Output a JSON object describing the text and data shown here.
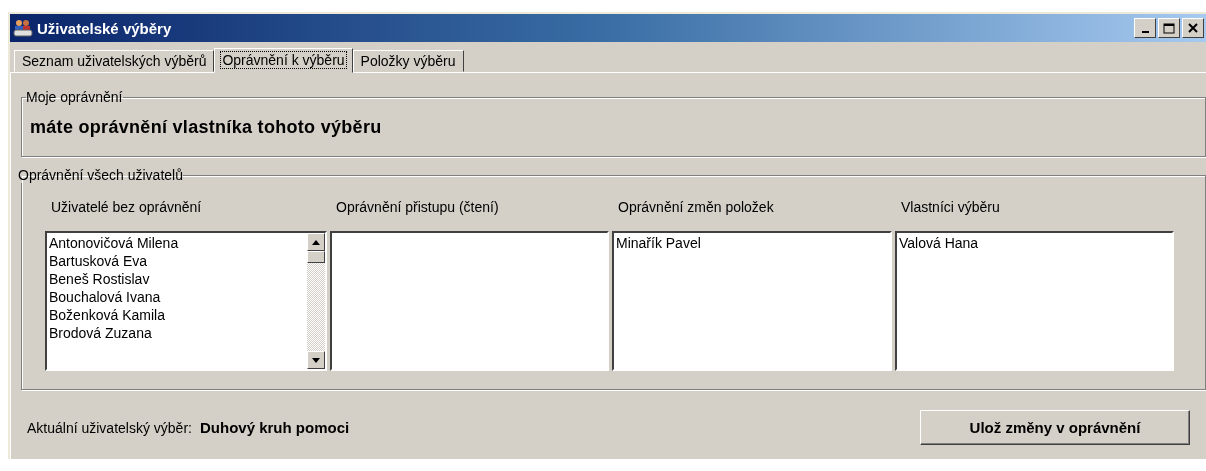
{
  "window": {
    "title": "Uživatelské výběry"
  },
  "tabs": [
    {
      "label": "Seznam uživatelských výběrů",
      "selected": false
    },
    {
      "label": "Oprávnění k výběru",
      "selected": true
    },
    {
      "label": "Položky výběru",
      "selected": false
    }
  ],
  "my_permission": {
    "legend": "Moje oprávnění",
    "text": "máte oprávnění vlastníka tohoto výběru"
  },
  "all_permissions": {
    "legend": "Oprávnění všech uživatelů",
    "columns": [
      {
        "heading": "Uživatelé bez oprávnění",
        "items": [
          "Antonovičová Milena",
          "Bartusková Eva",
          "Beneš Rostislav",
          "Bouchalová Ivana",
          "Boženková Kamila",
          "Brodová Zuzana"
        ],
        "scrollbar": true
      },
      {
        "heading": "Oprávnění přistupu (čtení)",
        "scrollbar": false
      },
      {
        "heading": "Oprávnění změn položek",
        "items": [
          "Minařík Pavel"
        ],
        "scrollbar": false
      },
      {
        "heading": "Vlastníci výběru",
        "items": [
          "Valová Hana"
        ],
        "scrollbar": false
      }
    ]
  },
  "footer": {
    "label": "Aktuální uživatelský výběr:",
    "value": "Duhový kruh pomoci",
    "button": "Ulož změny v oprávnění"
  }
}
